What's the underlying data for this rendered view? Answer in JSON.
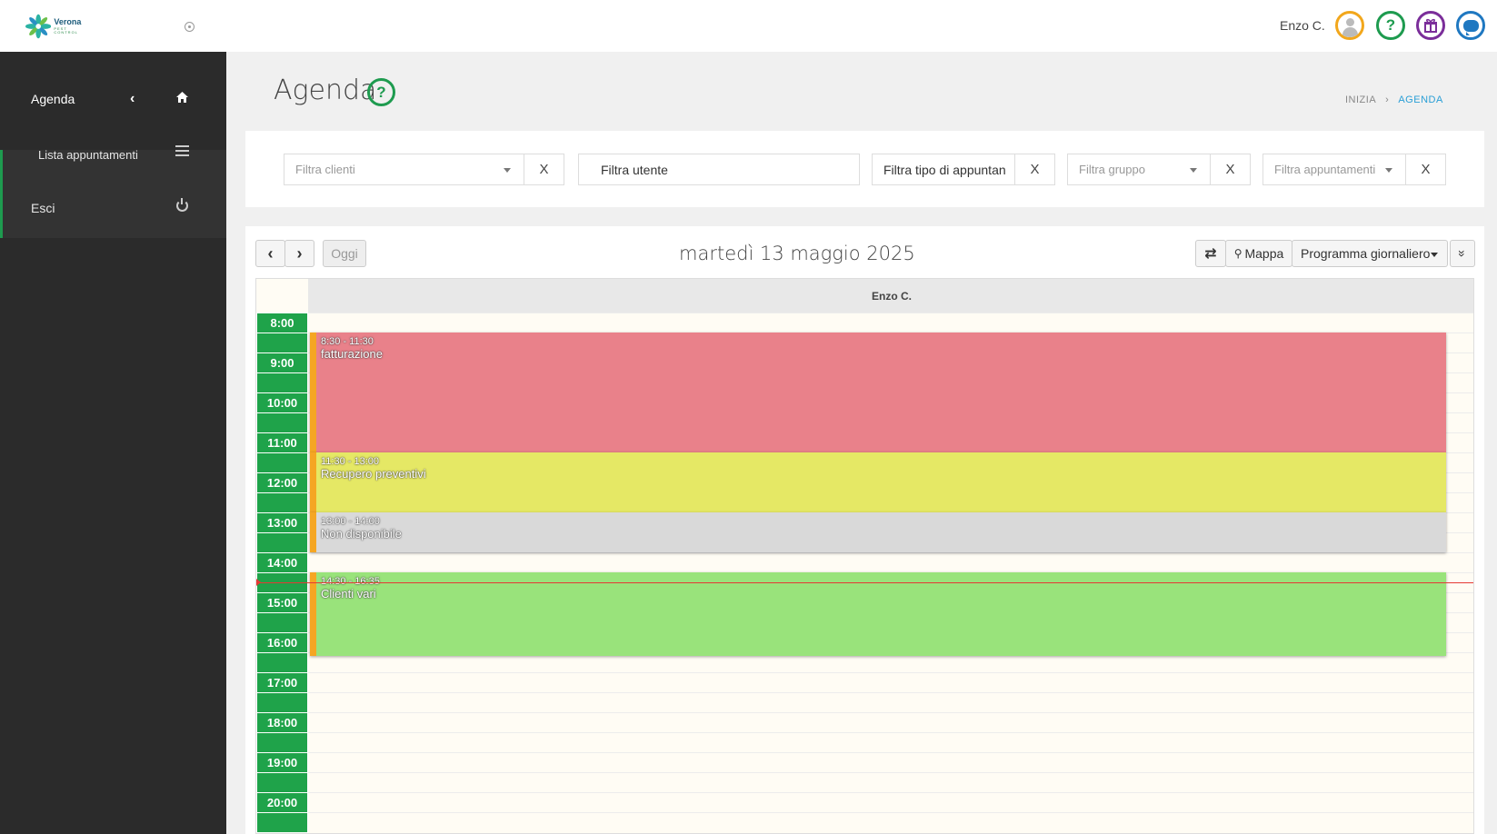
{
  "brand": {
    "name": "Verona",
    "tagline": "PEST CONTROL"
  },
  "header": {
    "user_name": "Enzo C.",
    "icons": [
      "user-avatar-icon",
      "help-icon",
      "gift-icon",
      "chat-icon"
    ],
    "help_glyph": "?",
    "gift_glyph": "🎁"
  },
  "sidebar": {
    "items": [
      {
        "label": "Agenda",
        "icon": "home-icon"
      },
      {
        "label": "Lista appuntamenti",
        "icon": "list-icon"
      },
      {
        "label": "Esci",
        "icon": "power-icon"
      }
    ],
    "collapse_glyph": "‹",
    "home_glyph": "⌂"
  },
  "page": {
    "title": "Agenda",
    "help_glyph": "?",
    "breadcrumb": {
      "home": "INIZIA",
      "separator": "›",
      "current": "AGENDA"
    }
  },
  "filters": {
    "clients_placeholder": "Filtra clienti",
    "user_value": "Filtra utente",
    "type_value": "Filtra tipo di appuntan",
    "group_placeholder": "Filtra gruppo",
    "appointments_placeholder": "Filtra appuntamenti",
    "clear_label": "X"
  },
  "calendar": {
    "prev_glyph": "‹",
    "next_glyph": "›",
    "today_label": "Oggi",
    "date_title": "martedì 13 maggio 2025",
    "swap_glyph": "⇄",
    "map_label": "Mappa",
    "map_glyph": "⚲",
    "view_label": "Programma giornaliero",
    "more_glyph": "»",
    "resource": "Enzo C.",
    "hours": [
      "8:00",
      "9:00",
      "10:00",
      "11:00",
      "12:00",
      "13:00",
      "14:00",
      "15:00",
      "16:00",
      "17:00",
      "18:00",
      "19:00",
      "20:00"
    ],
    "current_time": "14:45",
    "events": [
      {
        "time": "8:30 - 11:30",
        "title": "fatturazione",
        "color": "#e9818a"
      },
      {
        "time": "11:30 - 13:00",
        "title": "Recupero preventivi",
        "color": "#e5e865"
      },
      {
        "time": "13:00 - 14:00",
        "title": "Non disponibile",
        "color": "#d9d9d9"
      },
      {
        "time": "14:30 - 16:35",
        "title": "Clienti vari",
        "color": "#99e37b"
      }
    ]
  }
}
